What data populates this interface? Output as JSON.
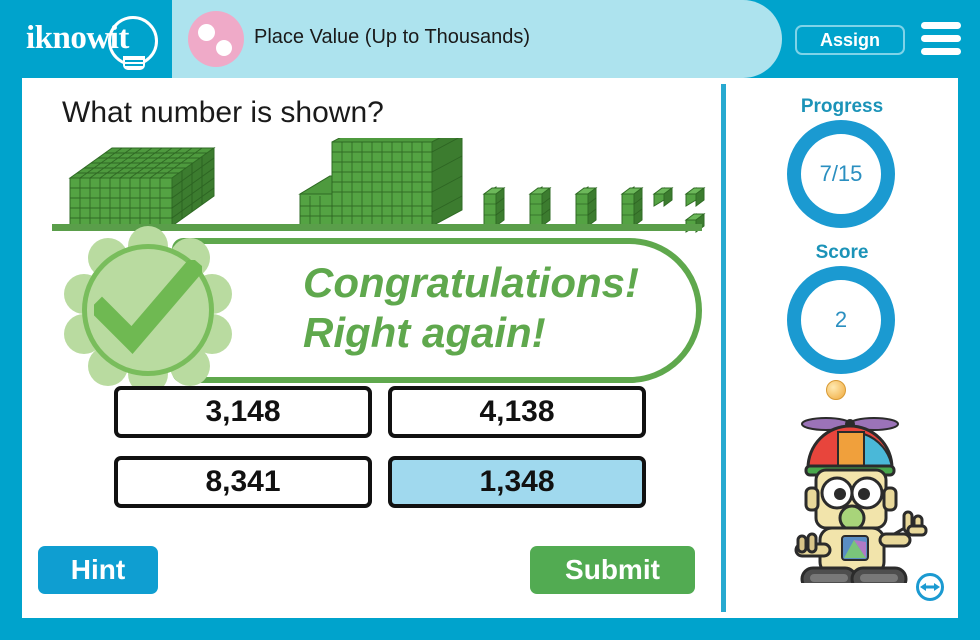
{
  "header": {
    "logo_text": "iknowit",
    "logo_icon": "lightbulb-icon",
    "avatar_icon": "pink-dots-avatar-icon",
    "lesson_title": "Place Value (Up to Thousands)",
    "assign_label": "Assign",
    "menu_icon": "hamburger-menu-icon"
  },
  "main": {
    "question": "What number is shown?",
    "feedback": {
      "line1": "Congratulations!",
      "line2": "Right again!",
      "badge_icon": "check-mark-badge-icon"
    },
    "options": [
      {
        "label": "3,148",
        "selected": false
      },
      {
        "label": "4,138",
        "selected": false
      },
      {
        "label": "8,341",
        "selected": false
      },
      {
        "label": "1,348",
        "selected": true
      }
    ],
    "hint_label": "Hint",
    "submit_label": "Submit"
  },
  "sidebar": {
    "progress_label": "Progress",
    "progress_value": "7/15",
    "score_label": "Score",
    "score_value": "2",
    "coin_icon": "gold-coin-icon",
    "mascot_icon": "robot-mascot-icon",
    "resize_icon": "resize-arrows-icon"
  },
  "blocks_data": {
    "description": "base-ten blocks representing 1,348",
    "thousands_cubes": 1,
    "hundreds_flats": 3,
    "tens_rods": 4,
    "ones_units": 8,
    "block_color": "#4f9a3f"
  },
  "colors": {
    "brand_blue": "#00a3cc",
    "title_bar_blue": "#ade3ee",
    "accent_green": "#5fa84d",
    "submit_green": "#52ab52",
    "selected_blue": "#a0d9ee",
    "ring_blue": "#1b9ad1",
    "avatar_pink": "#efaac8"
  }
}
